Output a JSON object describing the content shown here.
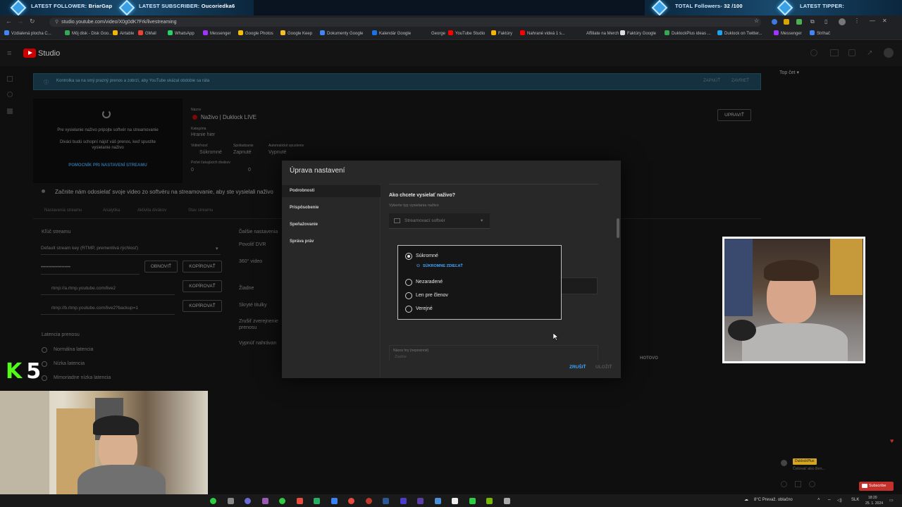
{
  "overlay": {
    "latest_follower_label": "LATEST FOLLOWER:",
    "latest_follower": "BriarGap",
    "latest_subscriber_label": "LATEST SUBSCRIBER:",
    "latest_subscriber": "Oucoriedka6",
    "total_followers_label": "TOTAL Followers-",
    "total_followers": "32 /100",
    "latest_tipper_label": "LATEST TIPPER:",
    "latest_tipper": "",
    "k5_k": "K",
    "k5_num": "5"
  },
  "browser": {
    "url": "studio.youtube.com/video/X0g0dK7Frk/livestreaming",
    "bookmarks": [
      {
        "label": "Vzdialená plocha C...",
        "color": "#4285f4"
      },
      {
        "label": "Môj disk - Disk Goo...",
        "color": "#34a853"
      },
      {
        "label": "Airtable",
        "color": "#f4b400"
      },
      {
        "label": "GMail",
        "color": "#ea4335"
      },
      {
        "label": "WhatsApp",
        "color": "#25d366"
      },
      {
        "label": "Messenger",
        "color": "#a033ff"
      },
      {
        "label": "Google Photos",
        "color": "#fbbc05"
      },
      {
        "label": "Google Keep",
        "color": "#f6bf26"
      },
      {
        "label": "Dokumenty Google",
        "color": "#4285f4"
      },
      {
        "label": "Kalendár Google",
        "color": "#1a73e8"
      },
      {
        "label": "George",
        "color": "#202124"
      },
      {
        "label": "YouTube Studio",
        "color": "#ff0000"
      },
      {
        "label": "Faktúry",
        "color": "#f4b400"
      },
      {
        "label": "Nahrané videá 1 s...",
        "color": "#ff0000"
      },
      {
        "label": "Affiliate na Merch",
        "color": "#202124"
      },
      {
        "label": "Faktúry Google",
        "color": "#dddddd"
      },
      {
        "label": "DuklockPlus ideas ...",
        "color": "#34a853"
      },
      {
        "label": "Duklock on Twitter...",
        "color": "#1da1f2"
      },
      {
        "label": "Messenger",
        "color": "#a033ff"
      },
      {
        "label": "Stríhač",
        "color": "#4285f4"
      }
    ]
  },
  "studio": {
    "logo_text": "Studio",
    "top_chat": "Top čet",
    "banner_text": "Kontrolka sa na smý prazný prenos a zobrzí, aby YouTube ukázal obdobie sa ráta",
    "banner_turn_on": "ZAPNÚŤ",
    "banner_close": "ZAVRIEŤ",
    "preview_line1": "Pre vysielanie naživo pripojte softvér na streamovanie",
    "preview_line2": "Diváci budú schopní nájsť váš prenos, keď spustíte vysielanie naživo",
    "preview_link": "POMOCNÍK PRI NASTAVENÍ STREAMU",
    "title_label": "Názov",
    "title": "Naživo | Duklock LIVE",
    "category_label": "Kategória",
    "category": "Hranie hier",
    "viz_label": "Viditeľnosť",
    "viz_value": "Súkromné",
    "chat_label": "Spoliadzanie",
    "chat_value": "Zapnuté",
    "auto_label": "Automatické spustenie",
    "auto_value": "Vypnuté",
    "viewers_label": "Počet čakajúcich divákov",
    "viewers": "0",
    "likes": "0",
    "edit_button": "UPRAVIŤ",
    "start_notice": "Začnite nám odosielať svoje video zo softvéru na streamovanie, aby ste vysielali naživo",
    "tabs": [
      "Nastavenia streamu",
      "Analytika",
      "Aktivita divákov",
      "Stav streamu"
    ],
    "stream_key_label": "Kľúč streamu",
    "stream_key_value": "Default stream key (RTMP, premenlivá rýchlosť)",
    "masked_key": "••••••••••••••••••••",
    "reset_button": "OBNOVIŤ",
    "copy_button": "KOPÍROVAŤ",
    "rtmp1": "rtmp://a.rtmp.youtube.com/live2",
    "rtmp2": "rtmp://b.rtmp.youtube.com/live2?backup=1",
    "latency_label": "Latencia prenosu",
    "latency_normal": "Normálna latencia",
    "latency_low": "Nízka latencia",
    "latency_ultra": "Mimoriadne nízka latencia",
    "more_settings_label": "Ďalšie nastavenia",
    "dvr": "Povoliť DVR",
    "video360": "360° video",
    "none": "Žiadne",
    "captions": "Skryté titulky",
    "cancel_public": "Zrušiť zverejnenie prenosu",
    "turn_off": "Vypnúť nahrávan"
  },
  "modal": {
    "title": "Úprava nastavení",
    "side_items": [
      "Podrobnosti",
      "Prispôsobenie",
      "Speňažovanie",
      "Správa práv"
    ],
    "question": "Ako chcete vysielať naživo?",
    "subtitle": "Vyberte typ vysielania naživo",
    "software_select": "Streamovací softvér",
    "visibility_options": [
      "Súkromné",
      "Nezaradené",
      "Len pre členov",
      "Verejné"
    ],
    "selected_visibility": "Súkromné",
    "save_private": "SÚKROMNE ZDIEĽAŤ",
    "done": "HOTOVO",
    "game_label": "Názov hry (nepovinné)",
    "game_value": "Žiadne",
    "cancel": "ZRUŠIŤ",
    "save": "ULOŽIŤ"
  },
  "taskbar": {
    "weather": "8°C Prevaž. oblačno",
    "lang": "SLK",
    "time": "18:20",
    "date": "25. 1. 2024"
  },
  "chat": {
    "badge": "DuklockPlus",
    "line": "Četovať ako člen...",
    "subscribe": "Subscribe"
  },
  "colors": {
    "accent_blue": "#3ea6ff",
    "youtube_red": "#ff0000",
    "modal_bg": "#282828"
  }
}
